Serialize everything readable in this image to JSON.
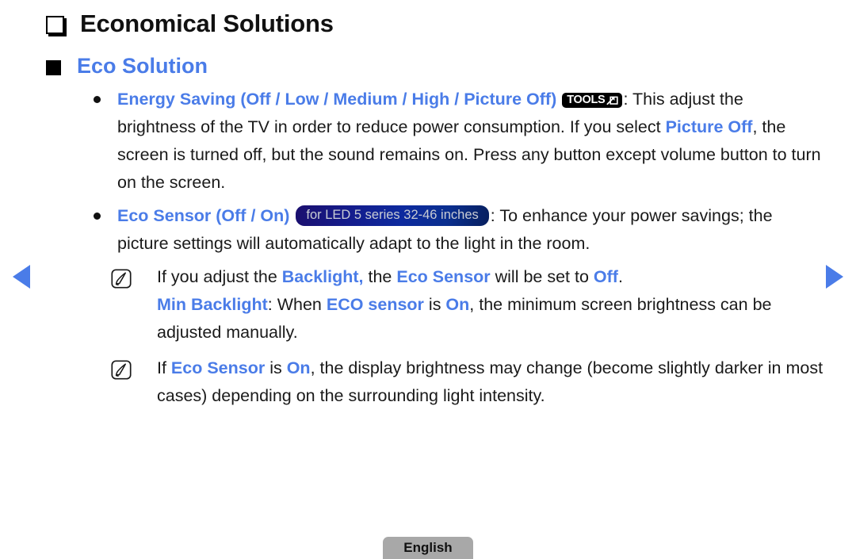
{
  "page": {
    "title": "Economical Solutions",
    "section": "Eco Solution",
    "title_bullet_icon": "outlined-square-icon",
    "section_bullet_icon": "filled-square-icon"
  },
  "colors": {
    "accent_blue": "#4a7ce8",
    "body_text": "#1a1a1a",
    "tools_badge_bg": "#000000",
    "model_badge_bg": "#0d2a9e",
    "model_badge_text": "#c8ccd4",
    "lang_button_bg": "#a8a8a8"
  },
  "badges": {
    "tools_label": "TOOLS",
    "tools_icon": "arrow-into-box-icon",
    "model_label": "for LED 5 series 32-46 inches"
  },
  "bullets": [
    {
      "id": "energy-saving",
      "heading": "Energy Saving (Off / Low / Medium / High / Picture Off)",
      "has_tools_badge": true,
      "segments": [
        {
          "text": ": This adjust the brightness of the TV in order to reduce power consumption. If you select ",
          "style": "plain"
        },
        {
          "text": "Picture Off",
          "style": "blue-bold"
        },
        {
          "text": ", the screen is turned off, but the sound remains on. Press any button except volume button to turn on the screen.",
          "style": "plain"
        }
      ]
    },
    {
      "id": "eco-sensor",
      "heading": "Eco Sensor (Off / On)",
      "has_model_badge": true,
      "segments": [
        {
          "text": ": To enhance your power savings; the picture settings will automatically adapt to the light in the room.",
          "style": "plain"
        }
      ]
    }
  ],
  "notes": [
    {
      "id": "note-backlight",
      "icon": "note-pen-icon",
      "segments": [
        {
          "text": "If you adjust the ",
          "style": "plain"
        },
        {
          "text": "Backlight,",
          "style": "blue-bold"
        },
        {
          "text": " the ",
          "style": "plain"
        },
        {
          "text": "Eco Sensor",
          "style": "blue-bold"
        },
        {
          "text": " will be set to ",
          "style": "plain"
        },
        {
          "text": "Off",
          "style": "blue-bold"
        },
        {
          "text": ".",
          "style": "plain"
        }
      ]
    },
    {
      "id": "min-backlight",
      "icon": null,
      "segments": [
        {
          "text": "Min Backlight",
          "style": "blue-bold"
        },
        {
          "text": ": When ",
          "style": "plain"
        },
        {
          "text": "ECO sensor",
          "style": "blue-bold"
        },
        {
          "text": " is ",
          "style": "plain"
        },
        {
          "text": "On",
          "style": "blue-bold"
        },
        {
          "text": ", the minimum screen brightness can be adjusted manually.",
          "style": "plain"
        }
      ]
    },
    {
      "id": "note-eco-sensor-on",
      "icon": "note-pen-icon",
      "segments": [
        {
          "text": "If ",
          "style": "plain"
        },
        {
          "text": "Eco Sensor",
          "style": "blue-bold"
        },
        {
          "text": " is ",
          "style": "plain"
        },
        {
          "text": "On",
          "style": "blue-bold"
        },
        {
          "text": ", the display brightness may change (become slightly darker in most cases) depending on the surrounding light intensity.",
          "style": "plain"
        }
      ]
    }
  ],
  "nav": {
    "prev_icon": "triangle-left-icon",
    "next_icon": "triangle-right-icon"
  },
  "footer": {
    "language_label": "English"
  }
}
